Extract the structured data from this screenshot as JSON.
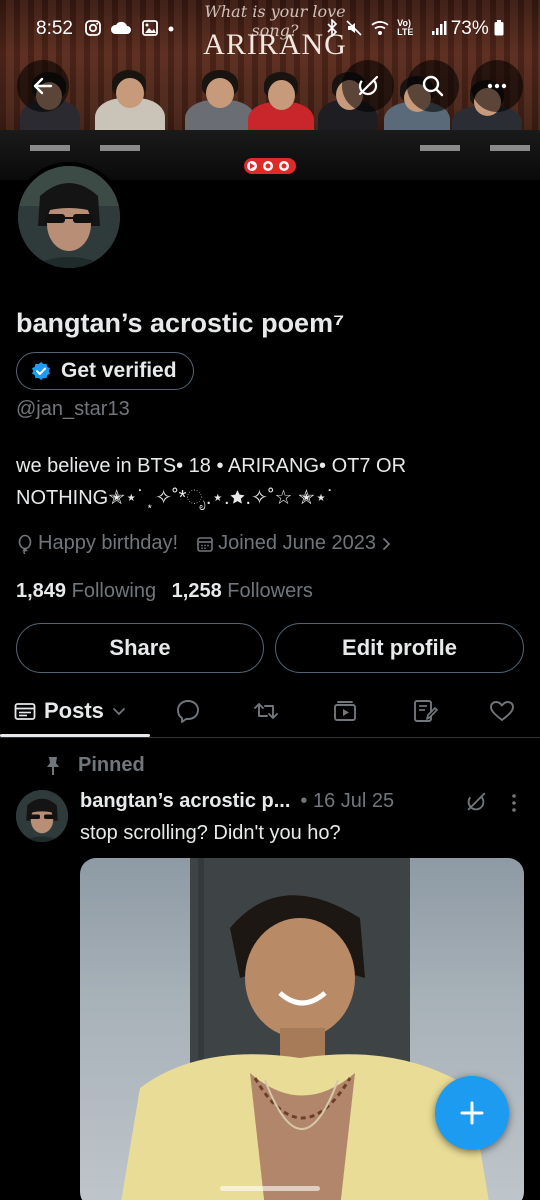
{
  "status_bar": {
    "time": "8:52",
    "notification_icons": [
      "instagram-icon",
      "cloud-icon",
      "gallery-icon",
      "dot-icon"
    ],
    "system_icons": [
      "bluetooth-icon",
      "mute-icon",
      "wifi-icon",
      "volte-icon",
      "signal-icon"
    ],
    "system_icons_text": "Vo) LTE",
    "battery": "73%"
  },
  "banner": {
    "script_text": "What is your love song?",
    "title": "ARIRANG"
  },
  "top_actions": {
    "icons": [
      "back-arrow-icon",
      "grok-icon",
      "search-icon",
      "more-icon"
    ]
  },
  "profile": {
    "display_name": "bangtan’s acrostic poem⁷",
    "verify_label": "Get verified",
    "handle": "@jan_star13",
    "bio_line1": "we believe in BTS• 18 • ARIRANG• OT7 OR",
    "bio_line2": "NOTHING✭⋆˙ ͙ ✧˚*ೃ.⋆.🟊.✧˚☆ ✭⋆˙",
    "birthday": "Happy birthday!",
    "joined": "Joined June 2023",
    "following_count": "1,849",
    "following_label": "Following",
    "followers_count": "1,258",
    "followers_label": "Followers",
    "share_label": "Share",
    "edit_label": "Edit profile"
  },
  "tabs": {
    "posts_label": "Posts",
    "icons": [
      "replies-icon",
      "retweet-icon",
      "media-icon",
      "articles-icon",
      "likes-icon"
    ]
  },
  "tweet": {
    "pinned_label": "Pinned",
    "author": "bangtan’s acrostic p...",
    "date": "• 16 Jul 25",
    "text": "stop scrolling? Didn't you ho?"
  },
  "colors": {
    "accent": "#1d9bf0",
    "background": "#000000",
    "text_primary": "#e7e9ea",
    "text_secondary": "#71767b",
    "border": "#536471"
  }
}
